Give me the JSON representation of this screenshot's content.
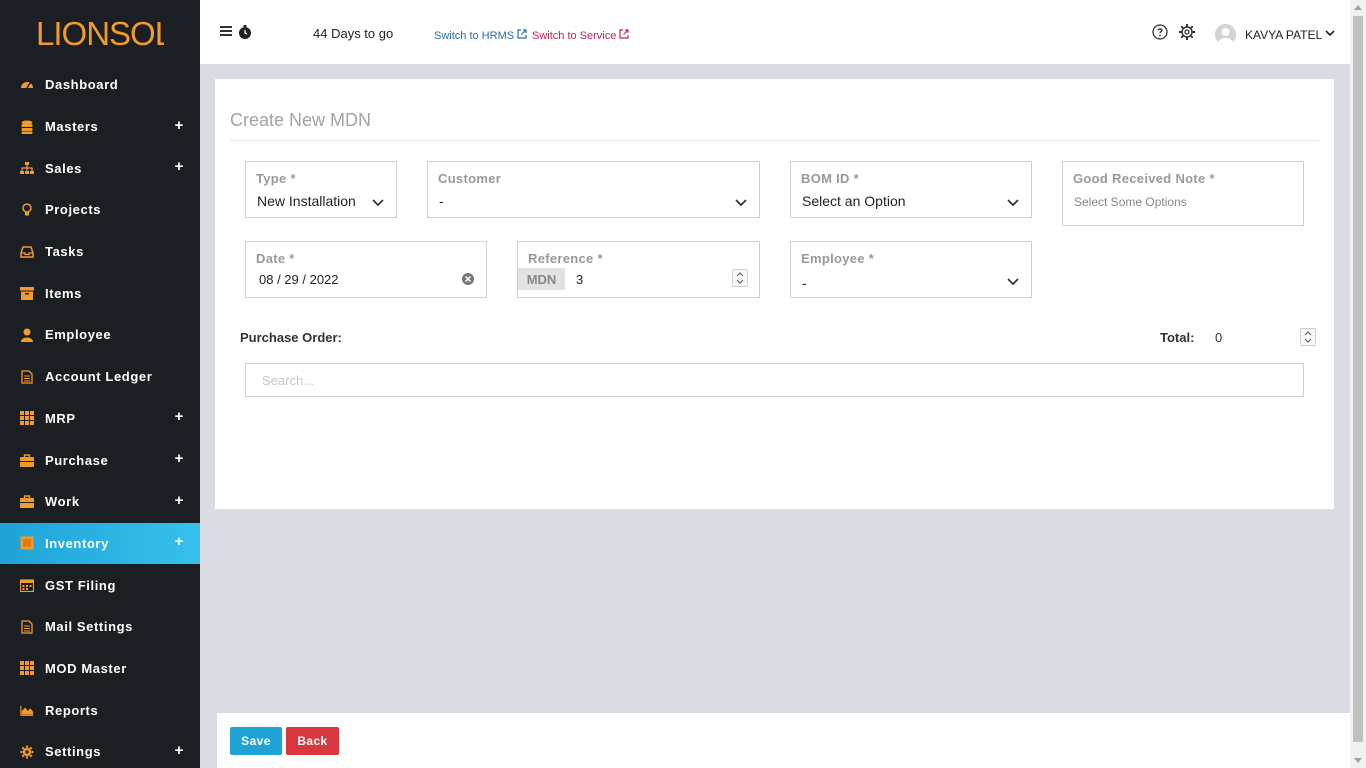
{
  "brand": {
    "logo_text": "LIONSOL",
    "accent": "#f39a2c"
  },
  "sidebar": {
    "items": [
      {
        "label": "Dashboard",
        "icon": "dashboard-icon",
        "expandable": false
      },
      {
        "label": "Masters",
        "icon": "database-icon",
        "expandable": true
      },
      {
        "label": "Sales",
        "icon": "sitemap-icon",
        "expandable": true
      },
      {
        "label": "Projects",
        "icon": "lightbulb-icon",
        "expandable": false
      },
      {
        "label": "Tasks",
        "icon": "inbox-icon",
        "expandable": false
      },
      {
        "label": "Items",
        "icon": "archive-icon",
        "expandable": false
      },
      {
        "label": "Employee",
        "icon": "user-icon",
        "expandable": false
      },
      {
        "label": "Account Ledger",
        "icon": "document-icon",
        "expandable": false
      },
      {
        "label": "MRP",
        "icon": "grid-icon",
        "expandable": true
      },
      {
        "label": "Purchase",
        "icon": "briefcase-icon",
        "expandable": true
      },
      {
        "label": "Work",
        "icon": "briefcase-icon",
        "expandable": true
      },
      {
        "label": "Inventory",
        "icon": "box-icon",
        "expandable": true,
        "active": true
      },
      {
        "label": "GST Filing",
        "icon": "calendar-icon",
        "expandable": false
      },
      {
        "label": "Mail Settings",
        "icon": "document-icon",
        "expandable": false
      },
      {
        "label": "MOD Master",
        "icon": "grid-icon",
        "expandable": false
      },
      {
        "label": "Reports",
        "icon": "area-chart-icon",
        "expandable": false
      },
      {
        "label": "Settings",
        "icon": "gear-icon",
        "expandable": true
      }
    ],
    "plus_glyph": "+"
  },
  "header": {
    "days_left": "44 Days to go",
    "switch_hrms": "Switch to HRMS",
    "switch_service": "Switch to Service",
    "user_name": "KAVYA PATEL"
  },
  "form": {
    "title": "Create New MDN",
    "type": {
      "label": "Type *",
      "value": "New Installation"
    },
    "customer": {
      "label": "Customer",
      "value": "-"
    },
    "bom": {
      "label": "BOM ID *",
      "value": "Select an Option"
    },
    "grn": {
      "label": "Good Received Note *",
      "placeholder": "Select Some Options"
    },
    "date": {
      "label": "Date *",
      "value": "08 / 29 / 2022"
    },
    "reference": {
      "label": "Reference *",
      "prefix": "MDN",
      "value": "3"
    },
    "employee": {
      "label": "Employee *",
      "value": "-"
    },
    "purchase_order_label": "Purchase Order:",
    "total_label": "Total:",
    "total_value": "0",
    "search_placeholder": "Search..."
  },
  "footer": {
    "save_label": "Save",
    "back_label": "Back"
  },
  "colors": {
    "sidebar_bg": "#1b1f24",
    "active": "#1fa3d6",
    "save": "#1fa3d6",
    "back": "#d9363e",
    "hrms_link": "#2a6ea8",
    "service_link": "#c7254e"
  }
}
